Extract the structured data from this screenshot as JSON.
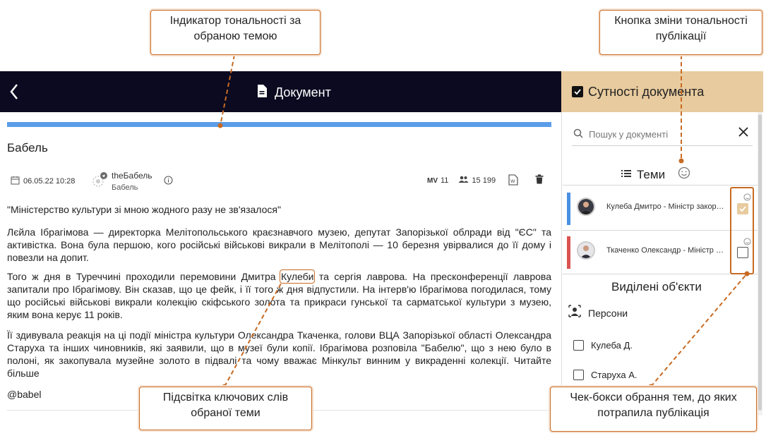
{
  "header": {
    "title": "Документ",
    "entities_label": "Сутності документа"
  },
  "search": {
    "placeholder": "Пошук у документі"
  },
  "themes": {
    "title": "Теми",
    "items": [
      {
        "name": "Кулеба Дмитро - Міністр закордонних справ",
        "color": "#4a90e2",
        "checked": true
      },
      {
        "name": "Ткаченко Олександр - Міністр культури",
        "color": "#d9534f",
        "checked": false
      }
    ]
  },
  "selected": {
    "title": "Виділені об'єкти",
    "persons_label": "Персони",
    "persons": [
      "Кулеба Д.",
      "Старуха А."
    ]
  },
  "article": {
    "title": "Бабель",
    "date": "06.05.22 10:28",
    "source_name": "theБабель",
    "source_sub": "Бабель",
    "views": "11",
    "views_prefix": "MV",
    "followers": "15 199",
    "quote": "\"Міністерство культури зі мною жодного разу не зв'язалося\"",
    "p1": "Лєйла Ібрагімова — директорка Мелітопольського краєзнавчого музею, депутат Запорізької облради від \"ЄС\" та активістка. Вона була першою, кого російські військові викрали в Мелітополі — 10 березня увірвалися до її дому і повезли на допит.",
    "p2_before": "Того ж дня в Туреччині проходили перемовини Дмитра ",
    "p2_kw": "Кулеби",
    "p2_after": " та сергія лаврова. На пресконференції лаврова запитали про Ібрагімову. Він сказав, що це фейк, і її того ж дня відпустили. На інтерв'ю Ібрагімова погодилася, тому що російські військові викрали колекцію скіфського золота та прикраси гунської та сарматської культури з музею, яким вона керує 11 років.",
    "p3": "Її здивувала реакція на ці події міністра культури Олександра Ткаченка, голови ВЦА Запорізької області Олександра Старуха та інших чиновників, які заявили, що в музеї були копії. Ібрагімова розповіла \"Бабелю\", що з нею було в полоні, як закопувала музейне золото в підвалі та чому вважає Мінкульт винним у викраденні колекції. Читайте більше",
    "handle": "@babel"
  },
  "callouts": {
    "tone_indicator": "Індикатор тональності за обраною темою",
    "tone_button": "Кнопка зміни тональності публікації",
    "keywords": "Підсвітка ключових слів обраної теми",
    "checkboxes": "Чек-бокси обрання тем, до яких потрапила публікація"
  },
  "colors": {
    "header_bg": "#0b0a20",
    "entities_bg": "#e8cb9e",
    "progress": "#5b9de8",
    "callout_border": "#c86a22"
  }
}
